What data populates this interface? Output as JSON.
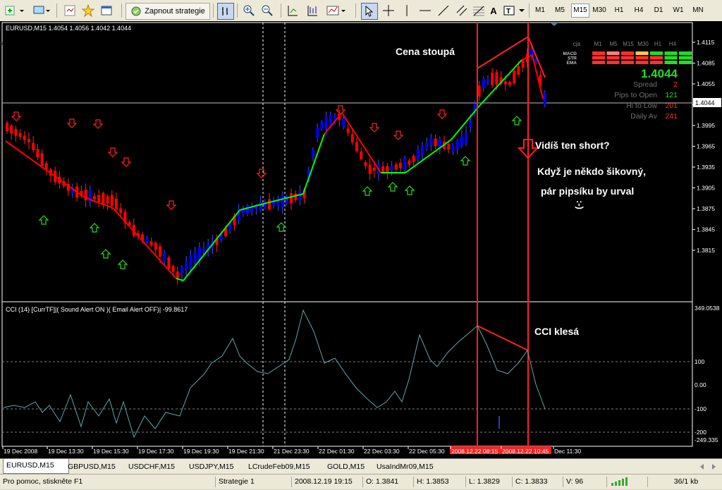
{
  "toolbar": {
    "strategy_button": "Zapnout strategie",
    "timeframes": [
      "M1",
      "M5",
      "M15",
      "M30",
      "H1",
      "H4",
      "D1",
      "W1",
      "MN"
    ],
    "active_timeframe": "M15"
  },
  "chart": {
    "header": "EURUSD,M15  1.4054 1.4056 1.4042 1.4044",
    "price_labels": [
      "1.4115",
      "1.4085",
      "1.4055",
      "1.4025",
      "1.3995",
      "1.3965",
      "1.3935",
      "1.3905",
      "1.3875",
      "1.3845",
      "1.3815"
    ],
    "current_price": "1.4044",
    "annotations": {
      "price_rising": "Cena stoupá",
      "see_short": "Vidíš ten short?",
      "line1": "Když je někdo šikovný,",
      "line2": "pár pipsíku by urval",
      "smiley": ":-)",
      "cci_falling": "CCI klesá"
    },
    "panel": {
      "tf_headers": [
        "cja",
        "M1",
        "M5",
        "M15",
        "M30",
        "H1",
        "H4",
        "D1"
      ],
      "rows": [
        "MACD",
        "STR",
        "EMA"
      ],
      "price": "1.4044",
      "stats": [
        {
          "label": "Spread",
          "value": "2"
        },
        {
          "label": "Pips to Open",
          "value": "121"
        },
        {
          "label": "Hi to Low",
          "value": "201"
        },
        {
          "label": "Daily Av",
          "value": "241"
        }
      ]
    },
    "colors": {
      "bull": "#0000ff",
      "bear": "#ff0000",
      "ma_up": "#00ff00",
      "ma_down": "#ff0000",
      "annotation": "#ff2020",
      "cci": "#5fa8a8"
    }
  },
  "cci": {
    "header": "CCI (14) [CurrTF]|( Sound Alert ON )( Email Alert OFF)| -99.8617",
    "labels": [
      "349.0538",
      "100",
      "0.00",
      "-100",
      "-200",
      "-249.335"
    ]
  },
  "time_axis": [
    "19 Dec 2008",
    "19 Dec 13:30",
    "19 Dec 15:30",
    "19 Dec 17:30",
    "19 Dec 19:30",
    "19 Dec 21:30",
    "21 Dec 23:30",
    "22 Dec 01:30",
    "22 Dec 03:30",
    "22 Dec 05:30",
    "2008.12.22 08:15",
    "2008.12.22 10:45",
    "Dec 11:30"
  ],
  "tabs": [
    "EURUSD,M15",
    "GBPUSD,M15",
    "USDCHF,M15",
    "USDJPY,M15",
    "LCrudeFeb09,M15",
    "GOLD,M15",
    "UsaIndMr09,M15"
  ],
  "status": {
    "help": "Pro pomoc, stiskněte F1",
    "profile": "Strategie 1",
    "datetime": "2008.12.19 19:15",
    "open": "O: 1.3841",
    "high": "H: 1.3853",
    "low": "L: 1.3829",
    "close": "C: 1.3833",
    "volume": "V: 96",
    "traffic": "36/1 kb"
  }
}
